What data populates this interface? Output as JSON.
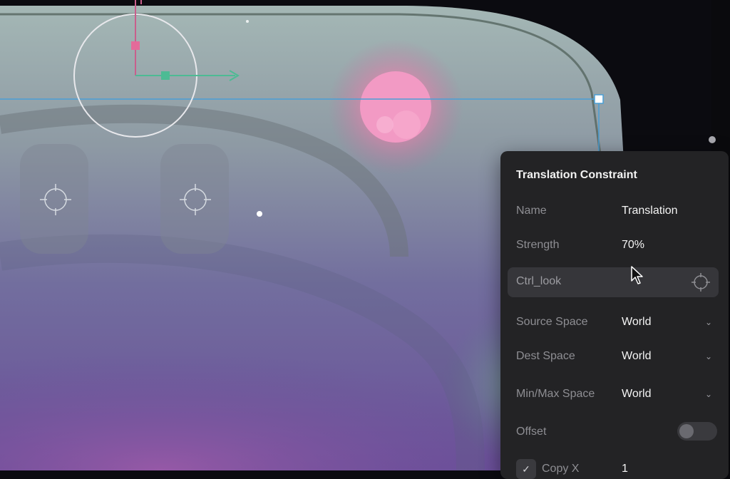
{
  "canvas": {
    "background": "#0b0b10",
    "accent_line": "#4a9fd6",
    "glow_color": "#f58bbd",
    "handle_pink": "#e46a9a",
    "handle_green": "#4dbb94"
  },
  "panel": {
    "title": "Translation Constraint",
    "name_label": "Name",
    "name_value": "Translation",
    "strength_label": "Strength",
    "strength_value": "70%",
    "target_label": "Ctrl_look",
    "target_icon": "crosshair-icon",
    "source_space_label": "Source Space",
    "source_space_value": "World",
    "dest_space_label": "Dest Space",
    "dest_space_value": "World",
    "minmax_space_label": "Min/Max Space",
    "minmax_space_value": "World",
    "offset_label": "Offset",
    "offset_on": false,
    "copy_x_label": "Copy X",
    "copy_x_checked": true,
    "copy_x_value": "1"
  }
}
